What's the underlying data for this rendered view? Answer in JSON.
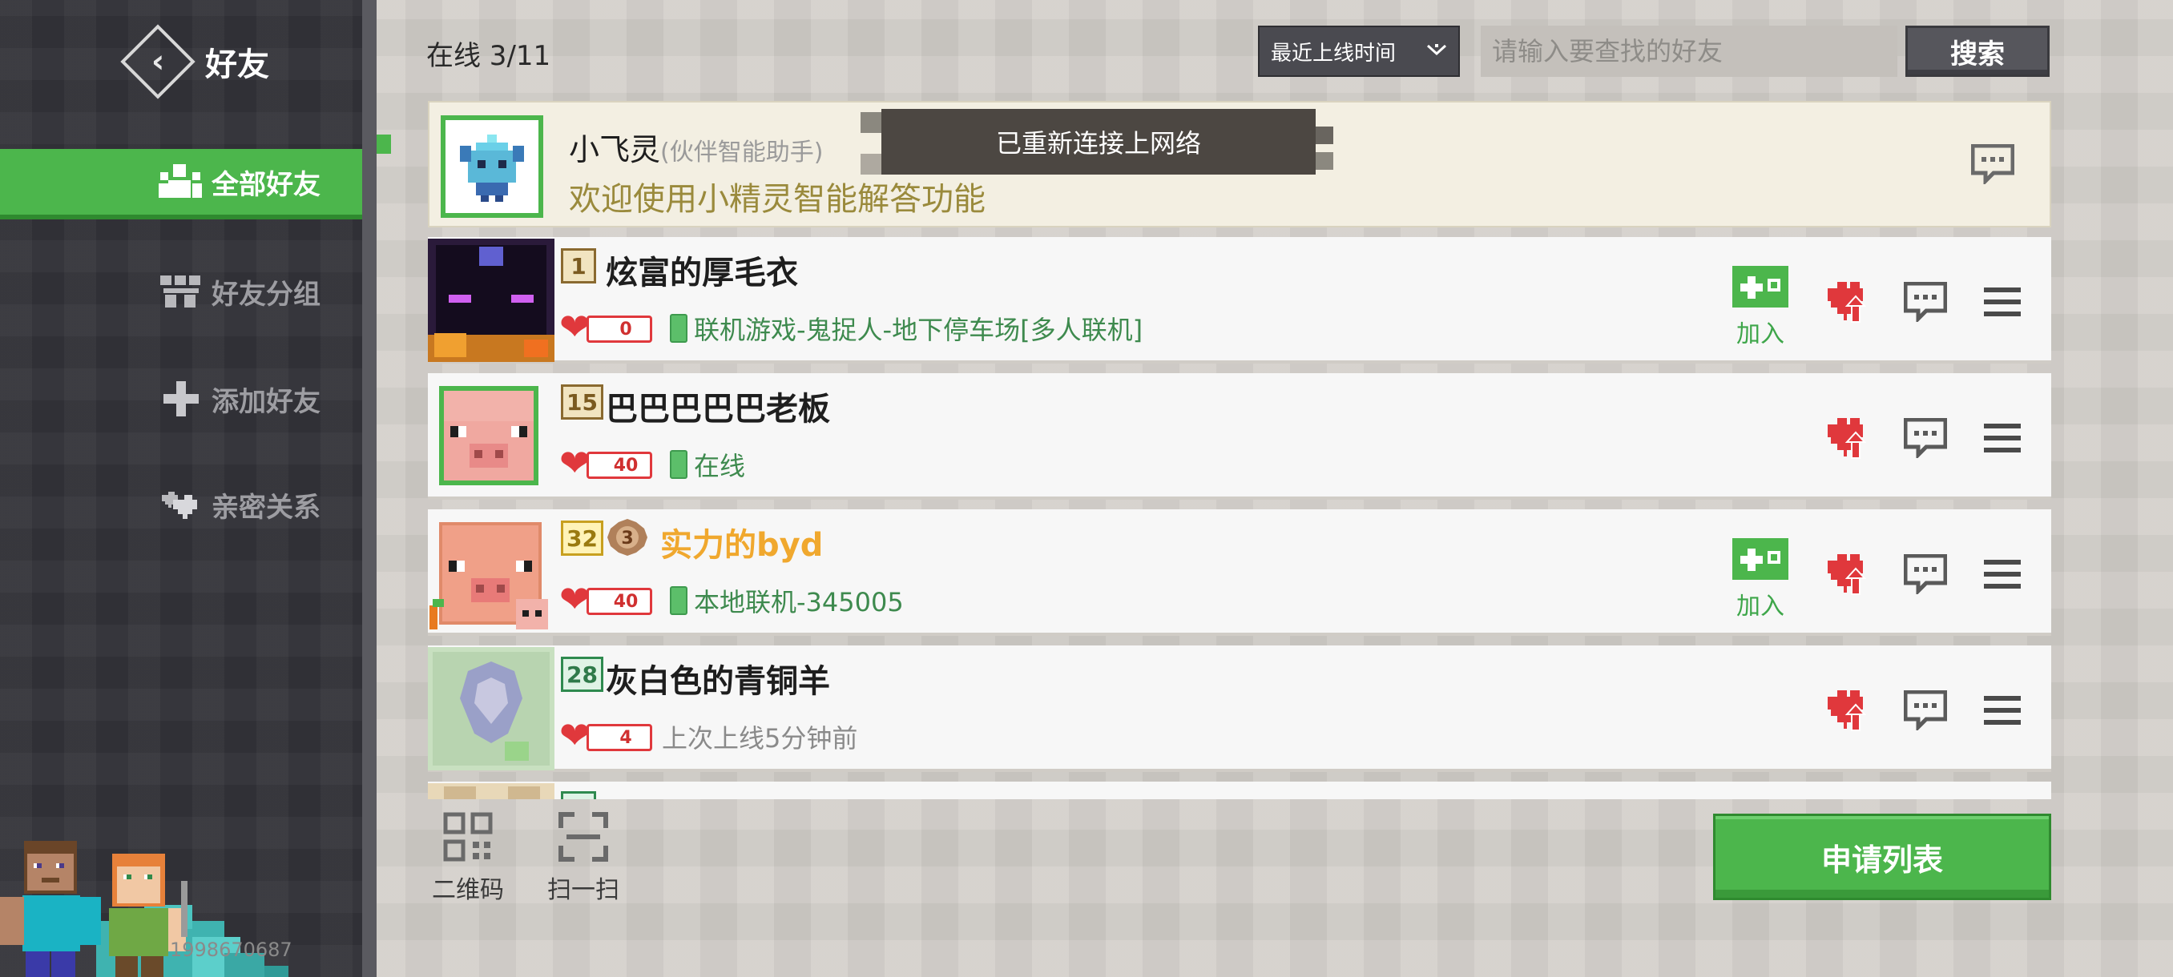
{
  "sidebar": {
    "title": "好友",
    "items": [
      {
        "label": "全部好友",
        "icon": "people-icon",
        "active": true
      },
      {
        "label": "好友分组",
        "icon": "group-icon",
        "active": false
      },
      {
        "label": "添加好友",
        "icon": "plus-icon",
        "active": false
      },
      {
        "label": "亲密关系",
        "icon": "hearts-icon",
        "active": false
      }
    ],
    "uid": "1998670687"
  },
  "topbar": {
    "online_count": "在线 3/11",
    "sort_selected": "最近上线时间",
    "search_placeholder": "请输入要查找的好友",
    "search_label": "搜索"
  },
  "toast": {
    "text": "已重新连接上网络"
  },
  "assistant": {
    "name": "小飞灵",
    "tag": "(伙伴智能助手)",
    "message": "欢迎使用小精灵智能解答功能"
  },
  "friends": [
    {
      "level": "1",
      "name": "炫富的厚毛衣",
      "hearts": "0",
      "status": "联机游戏-鬼捉人-地下停车场[多人联机]",
      "online": true,
      "joinable": true,
      "join_label": "加入"
    },
    {
      "level": "15",
      "name": "巴巴巴巴巴老板",
      "hearts": "40",
      "status": "在线",
      "online": true,
      "joinable": false
    },
    {
      "level": "32",
      "name": "实力的byd",
      "honor": "3",
      "hearts": "40",
      "status": "本地联机-345005",
      "online": true,
      "joinable": true,
      "join_label": "加入"
    },
    {
      "level": "28",
      "name": "灰白色的青铜羊",
      "hearts": "4",
      "status": "上次上线5分钟前",
      "online": false,
      "joinable": false
    }
  ],
  "bottom": {
    "qr_label": "二维码",
    "scan_label": "扫一扫",
    "request_list_label": "申请列表"
  },
  "colors": {
    "accent_green": "#4cb64c",
    "heart_red": "#e0383c",
    "sidebar_bg": "#34343a",
    "gold_name": "#f0a82e"
  }
}
